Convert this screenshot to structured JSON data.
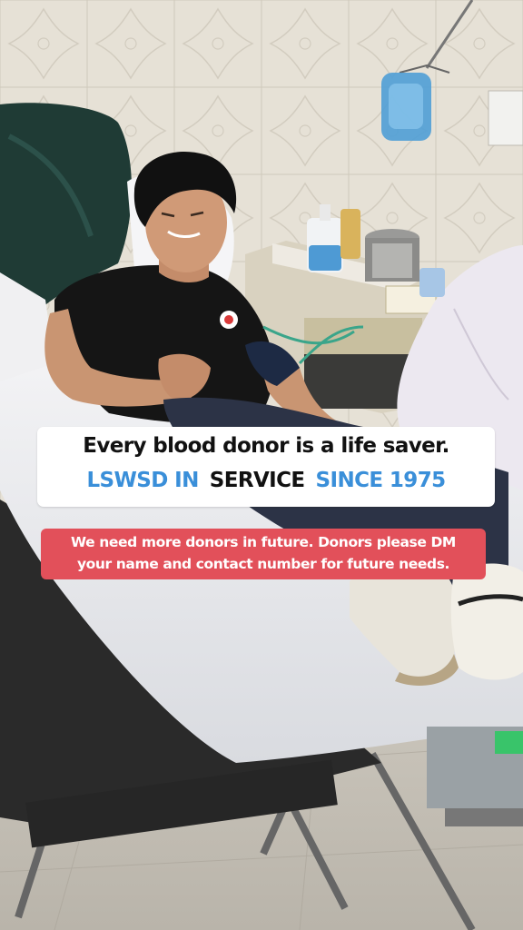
{
  "photo": {
    "subject": "",
    "tshirt_logo_color": "#d93a3a"
  },
  "caption": {
    "line1": "Every blood donor is a life saver.",
    "line2_part1": "LSWSD IN",
    "line2_part2": "SERVICE",
    "line2_part3": "SINCE 1975",
    "accent_color": "#3a8fd9",
    "box_color": "#ffffff"
  },
  "note": {
    "line1": "We need more donors in future. Donors please DM",
    "line2": "your name and contact number for future needs.",
    "box_color": "#e2505a",
    "text_color": "#ffffff"
  }
}
